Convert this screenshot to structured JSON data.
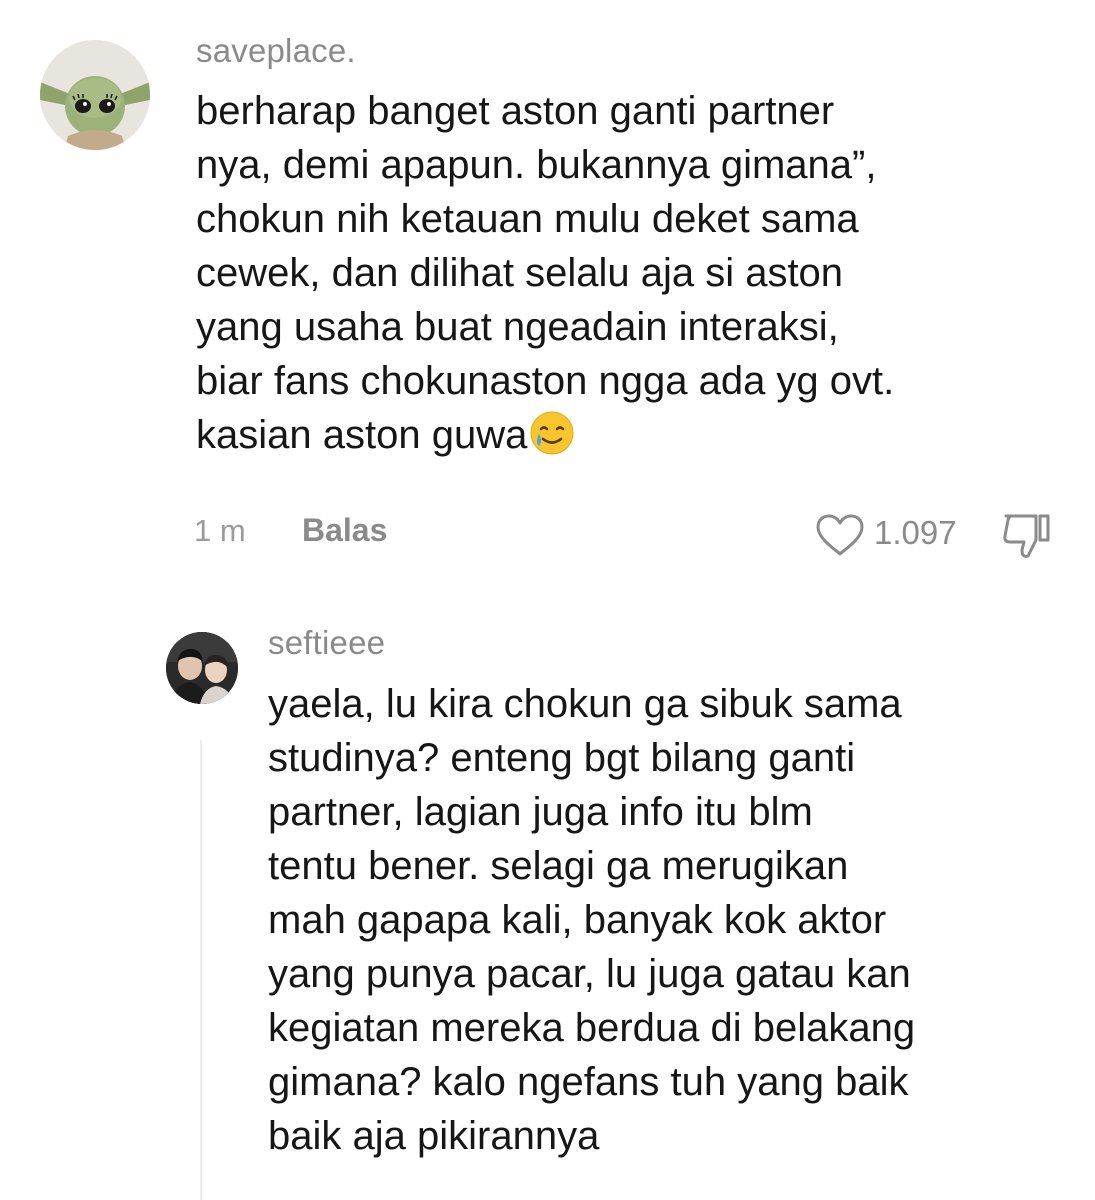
{
  "comments": [
    {
      "username": "saveplace.",
      "avatar_icon": "baby-yoda-avatar",
      "lines": [
        "berharap banget aston ganti partner",
        "nya, demi apapun. bukannya gimana”,",
        "chokun nih ketauan mulu deket sama",
        "cewek, dan dilihat selalu aja si aston",
        "yang usaha buat ngeadain interaksi,",
        "biar fans chokunaston ngga ada yg ovt.",
        "kasian aston guwa"
      ],
      "emoji": "smiling-face-with-tear-emoji",
      "time": "1 m",
      "reply_label": "Balas",
      "like_icon": "heart-outline-icon",
      "like_count": "1.097",
      "dislike_icon": "thumbs-down-icon"
    },
    {
      "username": "seftieee",
      "avatar_icon": "two-people-photo-avatar",
      "lines": [
        "yaela, lu kira chokun ga sibuk sama",
        "studinya? enteng bgt bilang ganti",
        "partner, lagian juga info itu blm",
        "tentu bener. selagi ga merugikan",
        "mah gapapa kali, banyak kok aktor",
        "yang punya pacar, lu juga gatau kan",
        "kegiatan mereka berdua di belakang",
        "gimana? kalo ngefans tuh yang baik",
        "baik aja pikirannya"
      ]
    }
  ],
  "colors": {
    "text": "#161616",
    "muted": "#8a8a8a",
    "thread_line": "#ececec"
  }
}
